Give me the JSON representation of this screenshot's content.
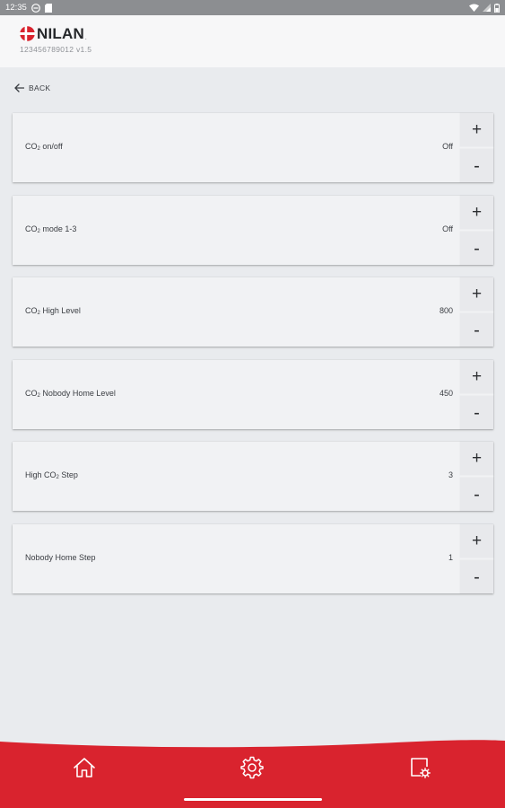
{
  "status_bar": {
    "time": "12:35"
  },
  "header": {
    "brand": "NILAN",
    "device_info": "123456789012  v1.5"
  },
  "back": {
    "label": "BACK"
  },
  "settings": [
    {
      "label_prefix": "CO",
      "label_sub": "2",
      "label_suffix": " on/off",
      "value": "Off"
    },
    {
      "label_prefix": "CO",
      "label_sub": "2",
      "label_suffix": " mode 1-3",
      "value": "Off"
    },
    {
      "label_prefix": "CO",
      "label_sub": "2",
      "label_suffix": " High Level",
      "value": "800"
    },
    {
      "label_prefix": "CO",
      "label_sub": "2",
      "label_suffix": " Nobody Home Level",
      "value": "450"
    },
    {
      "label_prefix": "High CO",
      "label_sub": "2",
      "label_suffix": " Step",
      "value": "3"
    },
    {
      "label_prefix": "Nobody Home Step",
      "label_sub": "",
      "label_suffix": "",
      "value": "1"
    }
  ],
  "stepper": {
    "plus_label": "+",
    "minus_label": "-"
  },
  "bottom_nav": {
    "items": [
      "home-icon",
      "gear-icon",
      "device-settings-icon"
    ],
    "active": "gear-icon"
  },
  "colors": {
    "brand_red": "#d9232e",
    "background": "#e9ebee",
    "card": "#f1f2f4",
    "stepper_button": "#e8e9ec",
    "status_bar": "#8c8e91"
  }
}
